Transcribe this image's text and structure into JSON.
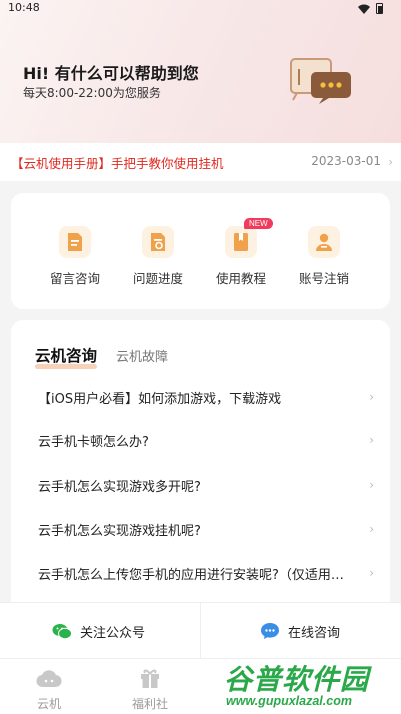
{
  "status": {
    "time": "10:48",
    "icons": [
      "wifi-icon",
      "battery-icon"
    ]
  },
  "header": {
    "greeting": "Hi! 有什么可以帮助到您",
    "service_hours": "每天8:00-22:00为您服务",
    "illustration": "chat-bubbles-icon"
  },
  "notice": {
    "text": "【云机使用手册】手把手教你使用挂机",
    "date": "2023-03-01"
  },
  "quick_actions": [
    {
      "label": "留言咨询",
      "icon": "message-doc-icon"
    },
    {
      "label": "问题进度",
      "icon": "progress-doc-icon"
    },
    {
      "label": "使用教程",
      "icon": "tutorial-book-icon",
      "badge": "NEW"
    },
    {
      "label": "账号注销",
      "icon": "user-icon"
    }
  ],
  "consult": {
    "tabs": [
      "云机咨询",
      "云机故障"
    ],
    "faq": [
      "【iOS用户必看】如何添加游戏，下载游戏",
      "云手机卡顿怎么办?",
      "云手机怎么实现游戏多开呢?",
      "云手机怎么实现游戏挂机呢?",
      "云手机怎么上传您手机的应用进行安装呢?（仅适用于安卓手机）"
    ]
  },
  "actions": {
    "follow": "关注公众号",
    "online": "在线咨询"
  },
  "tabbar": [
    {
      "label": "云机",
      "icon": "cloud-icon"
    },
    {
      "label": "福利社",
      "icon": "gift-icon"
    }
  ],
  "watermark": {
    "brand": "谷普软件园",
    "url": "www.gupuxlazal.com"
  },
  "colors": {
    "accent": "#e0281f",
    "icon_orange": "#f0a24a",
    "wechat_green": "#2bb24c",
    "chat_blue": "#3a8ee6",
    "badge": "#f03b5c"
  }
}
